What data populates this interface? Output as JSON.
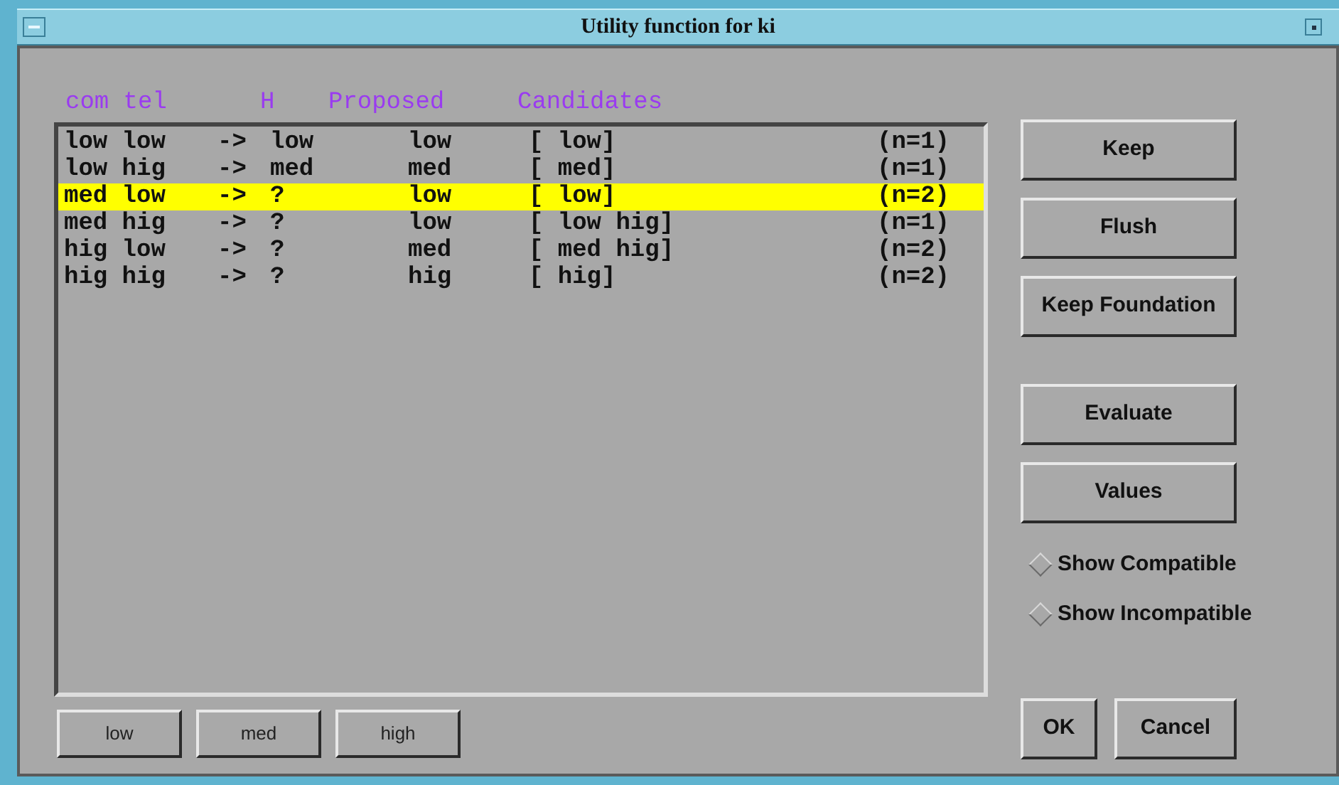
{
  "window": {
    "title": "Utility function for ki"
  },
  "header": [
    "com tel",
    "H",
    "Proposed",
    "Candidates"
  ],
  "rows": [
    {
      "inputs": "low low",
      "arrow": "->",
      "result": "low",
      "proposed": "low",
      "candidates": "[ low]",
      "count": "(n=1)",
      "selected": false
    },
    {
      "inputs": "low hig",
      "arrow": "->",
      "result": "med",
      "proposed": "med",
      "candidates": "[ med]",
      "count": "(n=1)",
      "selected": false
    },
    {
      "inputs": "med low",
      "arrow": "->",
      "result": "?",
      "proposed": "low",
      "candidates": "[ low]",
      "count": "(n=2)",
      "selected": true
    },
    {
      "inputs": "med hig",
      "arrow": "->",
      "result": "?",
      "proposed": "low",
      "candidates": "[ low hig]",
      "count": "(n=1)",
      "selected": false
    },
    {
      "inputs": "hig low",
      "arrow": "->",
      "result": "?",
      "proposed": "med",
      "candidates": "[ med hig]",
      "count": "(n=2)",
      "selected": false
    },
    {
      "inputs": "hig hig",
      "arrow": "->",
      "result": "?",
      "proposed": "hig",
      "candidates": "[ hig]",
      "count": "(n=2)",
      "selected": false
    }
  ],
  "side_buttons": [
    {
      "label": "Keep"
    },
    {
      "label": "Flush"
    },
    {
      "label": "Keep Foundation"
    },
    {
      "label": "Evaluate"
    },
    {
      "label": "Values"
    }
  ],
  "options": [
    {
      "label": "Show Compatible",
      "selected": false
    },
    {
      "label": "Show Incompatible",
      "selected": false
    }
  ],
  "value_buttons": [
    "low",
    "med",
    "high"
  ],
  "dialog_buttons": [
    "OK",
    "Cancel"
  ]
}
